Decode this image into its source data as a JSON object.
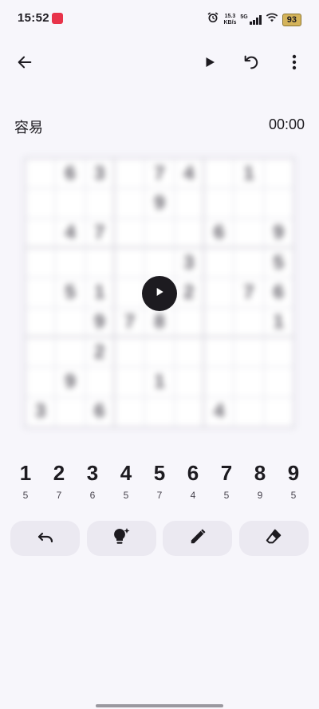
{
  "status": {
    "time": "15:52",
    "speed_value": "15.3",
    "speed_unit": "KB/s",
    "network": "5G",
    "battery": "93"
  },
  "header": {
    "difficulty": "容易",
    "timer": "00:00"
  },
  "board": {
    "cells": [
      "",
      "6",
      "3",
      "",
      "7",
      "4",
      "",
      "1",
      "",
      "",
      "",
      "",
      "",
      "9",
      "",
      "",
      "",
      "",
      "",
      "4",
      "7",
      "",
      "",
      "",
      "6",
      "",
      "9",
      "",
      "",
      "",
      "",
      "",
      "3",
      "",
      "",
      "5",
      "",
      "5",
      "1",
      "",
      "",
      "2",
      "",
      "7",
      "6",
      "",
      "",
      "9",
      "7",
      "8",
      "",
      "",
      "",
      "1",
      "",
      "",
      "2",
      "",
      "",
      "",
      "",
      "",
      "",
      "",
      "9",
      "",
      "",
      "1",
      "",
      "",
      "",
      "",
      "3",
      "",
      "6",
      "",
      "",
      "",
      "4",
      "",
      ""
    ]
  },
  "numpad": [
    {
      "digit": "1",
      "remaining": "5"
    },
    {
      "digit": "2",
      "remaining": "7"
    },
    {
      "digit": "3",
      "remaining": "6"
    },
    {
      "digit": "4",
      "remaining": "5"
    },
    {
      "digit": "5",
      "remaining": "7"
    },
    {
      "digit": "6",
      "remaining": "4"
    },
    {
      "digit": "7",
      "remaining": "5"
    },
    {
      "digit": "8",
      "remaining": "9"
    },
    {
      "digit": "9",
      "remaining": "5"
    }
  ],
  "icons": {
    "back": "arrow-left-icon",
    "play": "play-icon",
    "restart": "restart-icon",
    "more": "more-vert-icon",
    "undo": "undo-icon",
    "hint": "lightbulb-sparkle-icon",
    "notes": "pencil-icon",
    "erase": "eraser-icon"
  },
  "colors": {
    "background": "#f7f6fb",
    "button": "#ebe9f1",
    "text": "#1d1b20",
    "battery": "#d4b35a"
  }
}
